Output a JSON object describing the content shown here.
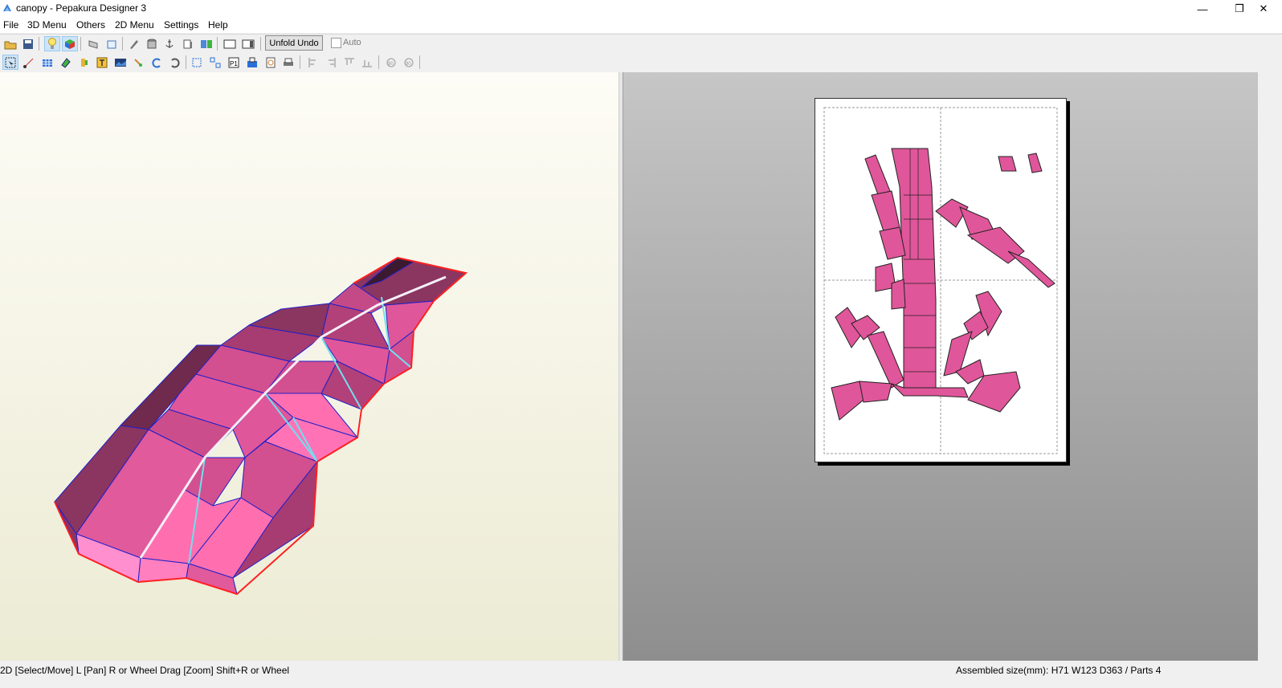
{
  "window": {
    "title": "canopy - Pepakura Designer 3",
    "minimize_glyph": "—",
    "maximize_glyph": "❐",
    "close_glyph": "✕"
  },
  "menu": [
    "File",
    "3D Menu",
    "Others",
    "2D Menu",
    "Settings",
    "Help"
  ],
  "toolbar": {
    "unfold_undo_label": "Unfold Undo",
    "auto_label": "Auto",
    "auto_checked": false,
    "row1_icons": [
      "open-icon",
      "save-icon",
      "lightbulb-icon",
      "texture-cube-icon",
      "fold-icon",
      "paper-stack-icon",
      "cylinder-icon",
      "anchor-icon",
      "page-setup-icon",
      "split-view-icon",
      "single-view-left-icon",
      "single-view-right-icon"
    ],
    "row2_icons": [
      "select-icon",
      "edit-edge-icon",
      "grid-icon",
      "join-icon",
      "flap-icon",
      "text-icon",
      "image-icon",
      "rotate-part-icon",
      "undo-rotate-icon",
      "redo-rotate-icon",
      "fit-page-icon",
      "arrange-icon",
      "page-number-icon",
      "layout-icon",
      "print-preview-icon",
      "print-icon",
      "align-left-icon",
      "align-right-icon",
      "align-top-icon",
      "align-bottom-icon",
      "rotate90-left-icon",
      "rotate90-right-icon"
    ]
  },
  "colors": {
    "model_pink": "#e0569a",
    "model_dark": "#8b3561",
    "model_light": "#ff7fbf",
    "edge_blue": "#2020c8",
    "cut_red": "#ff2020",
    "crease_cyan": "#6fe0f0"
  },
  "status": {
    "left": "2D [Select/Move] L [Pan] R or Wheel Drag [Zoom] Shift+R or Wheel",
    "right": "Assembled size(mm): H71 W123 D363 / Parts 4"
  }
}
